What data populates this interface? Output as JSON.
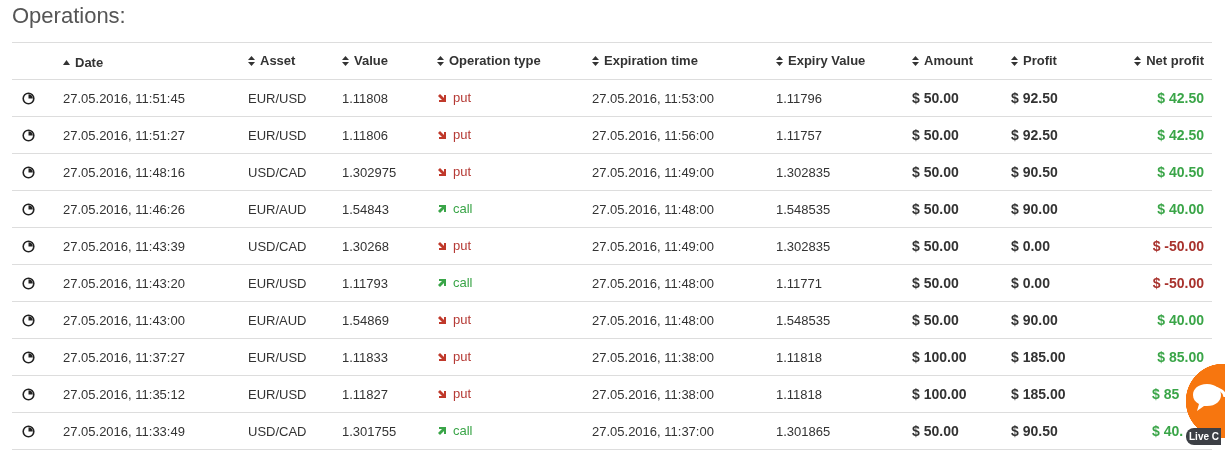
{
  "title": "Operations:",
  "table": {
    "columns": [
      {
        "label": "Date",
        "sorted": true
      },
      {
        "label": "Asset",
        "sorted": false
      },
      {
        "label": "Value",
        "sorted": false
      },
      {
        "label": "Operation type",
        "sorted": false
      },
      {
        "label": "Expiration time",
        "sorted": false
      },
      {
        "label": "Expiry Value",
        "sorted": false
      },
      {
        "label": "Amount",
        "sorted": false
      },
      {
        "label": "Profit",
        "sorted": false
      },
      {
        "label": "Net profit",
        "sorted": false
      }
    ],
    "rows": [
      {
        "date": "27.05.2016, 11:51:45",
        "asset": "EUR/USD",
        "value": "1.11808",
        "type": "put",
        "kind": "put",
        "expiration": "27.05.2016, 11:53:00",
        "expiry_value": "1.11796",
        "amount": "$ 50.00",
        "profit": "$ 92.50",
        "net_profit": "$ 42.50",
        "loss": false
      },
      {
        "date": "27.05.2016, 11:51:27",
        "asset": "EUR/USD",
        "value": "1.11806",
        "type": "put",
        "kind": "put",
        "expiration": "27.05.2016, 11:56:00",
        "expiry_value": "1.11757",
        "amount": "$ 50.00",
        "profit": "$ 92.50",
        "net_profit": "$ 42.50",
        "loss": false
      },
      {
        "date": "27.05.2016, 11:48:16",
        "asset": "USD/CAD",
        "value": "1.302975",
        "type": "put",
        "kind": "put",
        "expiration": "27.05.2016, 11:49:00",
        "expiry_value": "1.302835",
        "amount": "$ 50.00",
        "profit": "$ 90.50",
        "net_profit": "$ 40.50",
        "loss": false
      },
      {
        "date": "27.05.2016, 11:46:26",
        "asset": "EUR/AUD",
        "value": "1.54843",
        "type": "call",
        "kind": "call",
        "expiration": "27.05.2016, 11:48:00",
        "expiry_value": "1.548535",
        "amount": "$ 50.00",
        "profit": "$ 90.00",
        "net_profit": "$ 40.00",
        "loss": false
      },
      {
        "date": "27.05.2016, 11:43:39",
        "asset": "USD/CAD",
        "value": "1.30268",
        "type": "put",
        "kind": "put",
        "expiration": "27.05.2016, 11:49:00",
        "expiry_value": "1.302835",
        "amount": "$ 50.00",
        "profit": "$ 0.00",
        "net_profit": "$ -50.00",
        "loss": true
      },
      {
        "date": "27.05.2016, 11:43:20",
        "asset": "EUR/USD",
        "value": "1.11793",
        "type": "call",
        "kind": "call",
        "expiration": "27.05.2016, 11:48:00",
        "expiry_value": "1.11771",
        "amount": "$ 50.00",
        "profit": "$ 0.00",
        "net_profit": "$ -50.00",
        "loss": true
      },
      {
        "date": "27.05.2016, 11:43:00",
        "asset": "EUR/AUD",
        "value": "1.54869",
        "type": "put",
        "kind": "put",
        "expiration": "27.05.2016, 11:48:00",
        "expiry_value": "1.548535",
        "amount": "$ 50.00",
        "profit": "$ 90.00",
        "net_profit": "$ 40.00",
        "loss": false
      },
      {
        "date": "27.05.2016, 11:37:27",
        "asset": "EUR/USD",
        "value": "1.11833",
        "type": "put",
        "kind": "put",
        "expiration": "27.05.2016, 11:38:00",
        "expiry_value": "1.11818",
        "amount": "$ 100.00",
        "profit": "$ 185.00",
        "net_profit": "$ 85.00",
        "loss": false
      },
      {
        "date": "27.05.2016, 11:35:12",
        "asset": "EUR/USD",
        "value": "1.11827",
        "type": "put",
        "kind": "put",
        "expiration": "27.05.2016, 11:38:00",
        "expiry_value": "1.11818",
        "amount": "$ 100.00",
        "profit": "$ 185.00",
        "net_profit": "$ 85",
        "loss": false
      },
      {
        "date": "27.05.2016, 11:33:49",
        "asset": "USD/CAD",
        "value": "1.301755",
        "type": "call",
        "kind": "call",
        "expiration": "27.05.2016, 11:37:00",
        "expiry_value": "1.301865",
        "amount": "$ 50.00",
        "profit": "$ 90.50",
        "net_profit": "$ 40.",
        "loss": false
      }
    ]
  },
  "chat_widget": {
    "label": "Live C"
  }
}
